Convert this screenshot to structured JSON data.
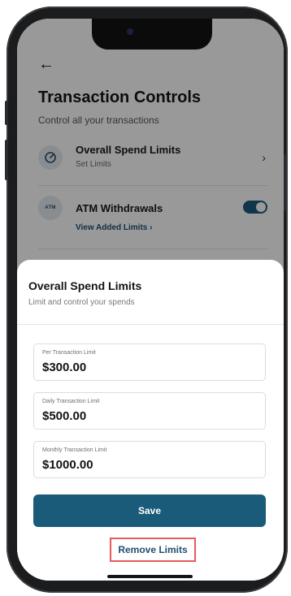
{
  "header": {
    "title": "Transaction Controls",
    "subtitle": "Control all your transactions"
  },
  "controls": [
    {
      "label": "Overall Spend Limits",
      "sub": "Set Limits"
    },
    {
      "label": "ATM Withdrawals",
      "icon_text": "ATM",
      "link": "View Added Limits",
      "link_icon": "›",
      "enabled": true
    }
  ],
  "sheet": {
    "title": "Overall Spend Limits",
    "subtitle": "Limit and control your spends",
    "fields": [
      {
        "label": "Per Transaction Limit",
        "value": "$300.00"
      },
      {
        "label": "Daily Transaction Limit",
        "value": "$500.00"
      },
      {
        "label": "Monthly Transaction Limit",
        "value": "$1000.00"
      }
    ],
    "save_label": "Save",
    "remove_label": "Remove Limits"
  },
  "colors": {
    "primary": "#1b5b7a",
    "highlight_border": "#e65a5e"
  }
}
